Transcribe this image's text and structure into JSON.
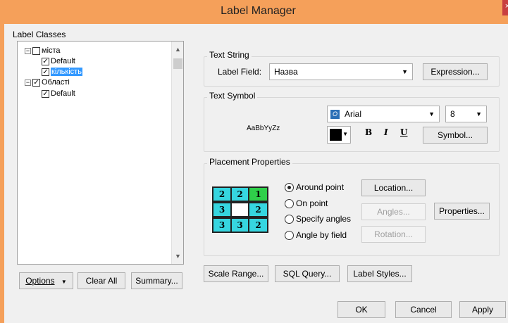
{
  "window": {
    "title": "Label Manager",
    "close_glyph": "×"
  },
  "label_classes": {
    "heading": "Label Classes",
    "tree": [
      {
        "label": "міста",
        "expander": "⊟",
        "checked": false,
        "level": 0
      },
      {
        "label": "Default",
        "checked": true,
        "level": 1
      },
      {
        "label": "кількість",
        "checked": true,
        "level": 1,
        "selected": true
      },
      {
        "label": "Області",
        "expander": "⊟",
        "checked": true,
        "level": 0
      },
      {
        "label": "Default",
        "checked": true,
        "level": 1
      }
    ],
    "scroll_up": "▲",
    "scroll_down": "▼"
  },
  "text_string": {
    "title": "Text String",
    "label_field_label": "Label Field:",
    "label_field_value": "Назва",
    "expression_button": "Expression..."
  },
  "text_symbol": {
    "title": "Text Symbol",
    "preview": "AaBbYyZz",
    "font_name": "Arial",
    "font_size": "8",
    "color": "#000000",
    "bold": "B",
    "italic": "I",
    "underline": "U",
    "symbol_button": "Symbol..."
  },
  "placement": {
    "title": "Placement Properties",
    "options": [
      {
        "label": "Around point",
        "selected": true
      },
      {
        "label": "On point",
        "selected": false
      },
      {
        "label": "Specify angles",
        "selected": false
      },
      {
        "label": "Angle by field",
        "selected": false
      }
    ],
    "location_button": "Location...",
    "angles_button": "Angles...",
    "rotation_button": "Rotation...",
    "properties_button": "Properties...",
    "grid": [
      "2",
      "2",
      "1",
      "3",
      "",
      "2",
      "3",
      "3",
      "2"
    ]
  },
  "bottom_buttons": {
    "options": "Options",
    "clear_all": "Clear All",
    "summary": "Summary...",
    "scale_range": "Scale Range...",
    "sql_query": "SQL Query...",
    "label_styles": "Label Styles..."
  },
  "dialog_buttons": {
    "ok": "OK",
    "cancel": "Cancel",
    "apply": "Apply"
  },
  "colors": {
    "title_bar": "#f5a05a",
    "selection": "#3399ff",
    "grid_cyan": "#36d6e0",
    "grid_green": "#2fcf4a"
  }
}
